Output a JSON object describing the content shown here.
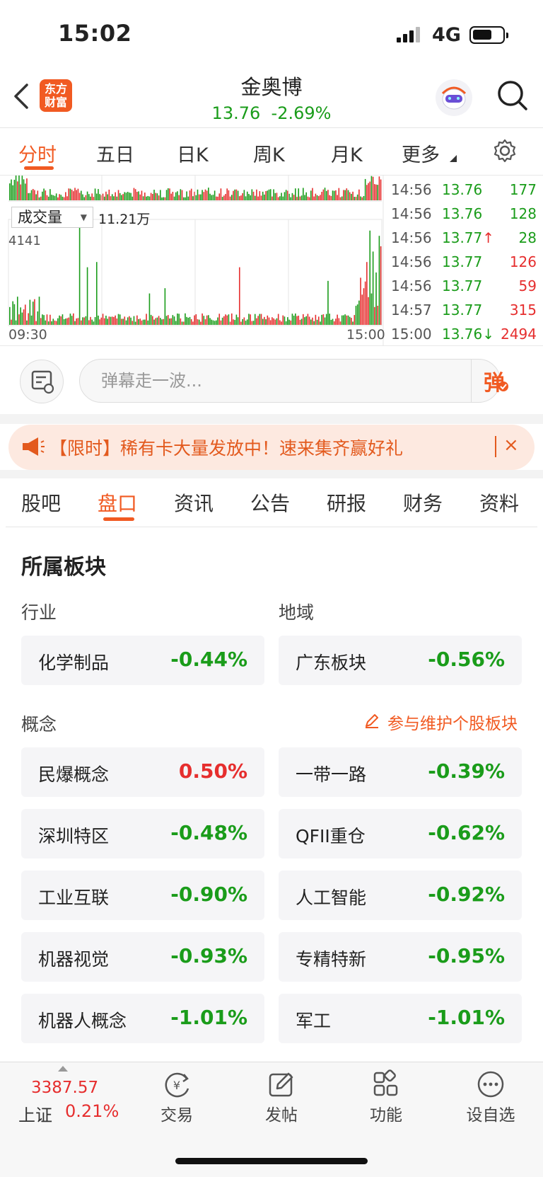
{
  "status_bar": {
    "time": "15:02",
    "network": "4G"
  },
  "header": {
    "app_logo": "东方\n财富",
    "stock_name": "金奥博",
    "price": "13.76",
    "change_pct": "-2.69%",
    "icons": [
      "back-icon",
      "robot-avatar-icon",
      "search-icon"
    ]
  },
  "chart_tabs": {
    "items": [
      "分时",
      "五日",
      "日K",
      "周K",
      "月K",
      "更多"
    ],
    "active": "分时"
  },
  "chart": {
    "volume_selector": "成交量",
    "volume_value": "11.21万",
    "volume_axis_max": "4141",
    "time_start": "09:30",
    "time_end": "15:00",
    "colors": {
      "up": "#e62e2e",
      "down": "#1a9c1a"
    }
  },
  "ticks": [
    {
      "time": "14:56",
      "price": "13.76",
      "arrow": "",
      "volume": "177",
      "price_color": "green",
      "vol_color": "green"
    },
    {
      "time": "14:56",
      "price": "13.76",
      "arrow": "",
      "volume": "128",
      "price_color": "green",
      "vol_color": "green"
    },
    {
      "time": "14:56",
      "price": "13.77",
      "arrow": "↑",
      "volume": "28",
      "price_color": "green",
      "vol_color": "green"
    },
    {
      "time": "14:56",
      "price": "13.77",
      "arrow": "",
      "volume": "126",
      "price_color": "green",
      "vol_color": "red"
    },
    {
      "time": "14:56",
      "price": "13.77",
      "arrow": "",
      "volume": "59",
      "price_color": "green",
      "vol_color": "red"
    },
    {
      "time": "14:57",
      "price": "13.77",
      "arrow": "",
      "volume": "315",
      "price_color": "green",
      "vol_color": "red"
    },
    {
      "time": "15:00",
      "price": "13.76",
      "arrow": "↓",
      "volume": "2494",
      "price_color": "green",
      "vol_color": "green"
    }
  ],
  "danmu": {
    "placeholder": "弹幕走一波...",
    "send_label": "弹"
  },
  "promo": {
    "text": "【限时】稀有卡大量发放中！速来集齐赢好礼",
    "close": "×"
  },
  "sub_tabs": {
    "items": [
      "股吧",
      "盘口",
      "资讯",
      "公告",
      "研报",
      "财务",
      "资料"
    ],
    "active": "盘口"
  },
  "sectors": {
    "title": "所属板块",
    "industry_label": "行业",
    "region_label": "地域",
    "industry": {
      "name": "化学制品",
      "change": "-0.44%"
    },
    "region": {
      "name": "广东板块",
      "change": "-0.56%"
    },
    "concept_label": "概念",
    "maintain_link": "参与维护个股板块",
    "concepts": [
      {
        "name": "民爆概念",
        "change": "0.50%",
        "color": "red"
      },
      {
        "name": "一带一路",
        "change": "-0.39%",
        "color": "green"
      },
      {
        "name": "深圳特区",
        "change": "-0.48%",
        "color": "green"
      },
      {
        "name": "QFII重仓",
        "change": "-0.62%",
        "color": "green"
      },
      {
        "name": "工业互联",
        "change": "-0.90%",
        "color": "green"
      },
      {
        "name": "人工智能",
        "change": "-0.92%",
        "color": "green"
      },
      {
        "name": "机器视觉",
        "change": "-0.93%",
        "color": "green"
      },
      {
        "name": "专精特新",
        "change": "-0.95%",
        "color": "green"
      },
      {
        "name": "机器人概念",
        "change": "-1.01%",
        "color": "green"
      },
      {
        "name": "军工",
        "change": "-1.01%",
        "color": "green"
      }
    ]
  },
  "bottom_nav": {
    "index_value": "3387.57",
    "index_name": "上证",
    "index_change": "0.21%",
    "items": [
      {
        "label": "交易",
        "icon": "trade-yen-icon"
      },
      {
        "label": "发帖",
        "icon": "post-edit-icon"
      },
      {
        "label": "功能",
        "icon": "grid-function-icon"
      },
      {
        "label": "设自选",
        "icon": "more-dots-icon"
      }
    ]
  }
}
